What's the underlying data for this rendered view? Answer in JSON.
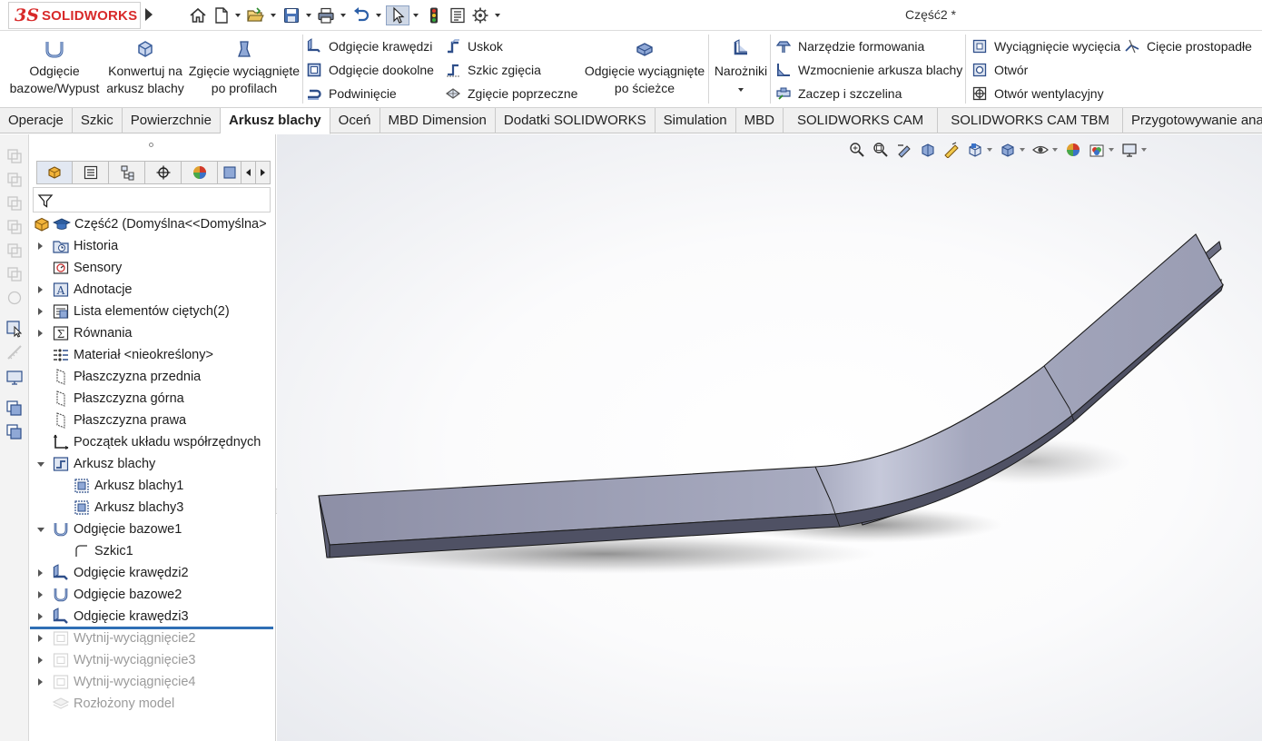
{
  "app": {
    "logo_prefix": "3S",
    "logo_text": "SOLIDWORKS",
    "document_title": "Część2 *"
  },
  "quick_access": {
    "icons": [
      "home-icon",
      "new-document-icon",
      "open-folder-icon",
      "save-icon",
      "print-icon",
      "undo-icon",
      "select-pointer-icon",
      "rebuild-traffic-light-icon",
      "file-properties-icon",
      "options-gear-icon"
    ]
  },
  "ribbon": {
    "large": [
      {
        "label": "Odgięcie bazowe/Wypust",
        "line1": "Odgięcie",
        "line2": "bazowe/Wypust"
      },
      {
        "label": "Konwertuj na arkusz blachy",
        "line1": "Konwertuj na",
        "line2": "arkusz blachy"
      },
      {
        "label": "Zgięcie wyciągnięte po profilach",
        "line1": "Zgięcie wyciągnięte",
        "line2": "po profilach"
      },
      {
        "label": "Odgięcie wyciągnięte po ścieżce",
        "line1": "Odgięcie wyciągnięte",
        "line2": "po ścieżce"
      },
      {
        "label": "Narożniki",
        "line1": "Narożniki",
        "line2": ""
      }
    ],
    "small": {
      "odgiecie_krawedzi": "Odgięcie krawędzi",
      "odgiecie_dookolne": "Odgięcie dookolne",
      "podwiniecie": "Podwinięcie",
      "uskok": "Uskok",
      "szkic_zgiecia": "Szkic zgięcia",
      "zgiecie_poprzeczne": "Zgięcie poprzeczne",
      "narzedzie_formowania": "Narzędzie formowania",
      "wzmocnienie": "Wzmocnienie arkusza blachy",
      "zaczep": "Zaczep i szczelina",
      "wyciagniecie_wyciecia": "Wyciągnięcie wycięcia",
      "otwor": "Otwór",
      "otwor_wentylacyjny": "Otwór wentylacyjny",
      "ciecie_prostopadle": "Cięcie prostopadłe"
    }
  },
  "tabs": [
    {
      "label": "Operacje",
      "active": false
    },
    {
      "label": "Szkic",
      "active": false
    },
    {
      "label": "Powierzchnie",
      "active": false
    },
    {
      "label": "Arkusz blachy",
      "active": true
    },
    {
      "label": "Oceń",
      "active": false
    },
    {
      "label": "MBD Dimension",
      "active": false
    },
    {
      "label": "Dodatki SOLIDWORKS",
      "active": false
    },
    {
      "label": "Simulation",
      "active": false
    },
    {
      "label": "MBD",
      "active": false
    },
    {
      "label": "SOLIDWORKS CAM",
      "active": false
    },
    {
      "label": "SOLIDWORKS CAM TBM",
      "active": false
    },
    {
      "label": "Przygotowywanie analizy",
      "active": false
    }
  ],
  "feature_tree": {
    "root": "Część2  (Domyślna<<Domyślna>",
    "items": [
      {
        "label": "Historia",
        "expander": "collapsed",
        "indent": 0,
        "icon": "history-folder-icon",
        "dim": false
      },
      {
        "label": "Sensory",
        "expander": "none",
        "indent": 0,
        "icon": "sensors-icon",
        "dim": false
      },
      {
        "label": "Adnotacje",
        "expander": "collapsed",
        "indent": 0,
        "icon": "annotations-icon",
        "dim": false
      },
      {
        "label": "Lista elementów ciętych(2)",
        "expander": "collapsed",
        "indent": 0,
        "icon": "cut-list-icon",
        "dim": false
      },
      {
        "label": "Równania",
        "expander": "collapsed",
        "indent": 0,
        "icon": "equations-icon",
        "dim": false
      },
      {
        "label": "Materiał <nieokreślony>",
        "expander": "none",
        "indent": 0,
        "icon": "material-icon",
        "dim": false
      },
      {
        "label": "Płaszczyzna przednia",
        "expander": "none",
        "indent": 0,
        "icon": "plane-icon",
        "dim": false
      },
      {
        "label": "Płaszczyzna górna",
        "expander": "none",
        "indent": 0,
        "icon": "plane-icon",
        "dim": false
      },
      {
        "label": "Płaszczyzna prawa",
        "expander": "none",
        "indent": 0,
        "icon": "plane-icon",
        "dim": false
      },
      {
        "label": "Początek układu współrzędnych",
        "expander": "none",
        "indent": 0,
        "icon": "origin-icon",
        "dim": false
      },
      {
        "label": "Arkusz blachy",
        "expander": "expanded",
        "indent": 0,
        "icon": "sheet-metal-folder-icon",
        "dim": false
      },
      {
        "label": "Arkusz blachy1",
        "expander": "none",
        "indent": 1,
        "icon": "sheet-metal-feature-icon",
        "dim": false
      },
      {
        "label": "Arkusz blachy3",
        "expander": "none",
        "indent": 1,
        "icon": "sheet-metal-feature-icon",
        "dim": false
      },
      {
        "label": "Odgięcie bazowe1",
        "expander": "expanded",
        "indent": 0,
        "icon": "base-flange-icon",
        "dim": false
      },
      {
        "label": "Szkic1",
        "expander": "none",
        "indent": 1,
        "icon": "sketch-icon",
        "dim": false
      },
      {
        "label": "Odgięcie krawędzi2",
        "expander": "collapsed",
        "indent": 0,
        "icon": "edge-flange-icon",
        "dim": false
      },
      {
        "label": "Odgięcie bazowe2",
        "expander": "collapsed",
        "indent": 0,
        "icon": "base-flange-icon",
        "dim": false
      },
      {
        "label": "Odgięcie krawędzi3",
        "expander": "collapsed",
        "indent": 0,
        "icon": "edge-flange-icon",
        "dim": false
      },
      {
        "label": "Wytnij-wyciągnięcie2",
        "expander": "collapsed",
        "indent": 0,
        "icon": "extruded-cut-icon",
        "dim": true
      },
      {
        "label": "Wytnij-wyciągnięcie3",
        "expander": "collapsed",
        "indent": 0,
        "icon": "extruded-cut-icon",
        "dim": true
      },
      {
        "label": "Wytnij-wyciągnięcie4",
        "expander": "collapsed",
        "indent": 0,
        "icon": "extruded-cut-icon",
        "dim": true
      },
      {
        "label": "Rozłożony model",
        "expander": "none",
        "indent": 0,
        "icon": "flat-pattern-icon",
        "dim": true
      }
    ]
  },
  "colors": {
    "brand_red": "#d82a2a",
    "rollback_bar": "#2f6fb5",
    "model_face_light": "#b9bccd",
    "model_face_dark": "#6e7084",
    "model_edge": "#1a1a1a"
  }
}
